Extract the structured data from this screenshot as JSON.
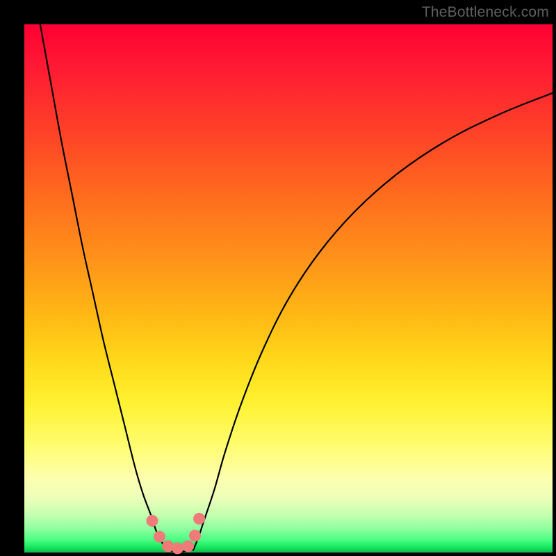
{
  "watermark": "TheBottleneck.com",
  "colors": {
    "frame": "#000000",
    "curve_stroke": "#000000",
    "marker_fill": "#ef7b78",
    "marker_stroke": "#c96562",
    "gradient_top": "#ff0033",
    "gradient_bottom": "#0fb74a"
  },
  "chart_data": {
    "type": "line",
    "title": "",
    "xlabel": "",
    "ylabel": "",
    "xlim": [
      0,
      100
    ],
    "ylim": [
      0,
      100
    ],
    "grid": false,
    "legend": false,
    "series": [
      {
        "name": "left-curve",
        "x": [
          3,
          5,
          7,
          9,
          11,
          13,
          15,
          17,
          19,
          21,
          22.5,
          24,
          25,
          26,
          27
        ],
        "y": [
          100,
          89,
          78,
          68,
          58,
          49,
          40,
          32,
          24,
          16,
          11,
          7,
          4,
          2,
          0.5
        ]
      },
      {
        "name": "right-curve",
        "x": [
          32,
          33,
          34,
          36,
          38,
          41,
          45,
          50,
          56,
          63,
          71,
          80,
          90,
          100
        ],
        "y": [
          0.5,
          3,
          6,
          12,
          19,
          28,
          38,
          48,
          57,
          65,
          72,
          78,
          83,
          87
        ]
      },
      {
        "name": "valley-floor",
        "x": [
          27,
          28.5,
          30,
          31,
          32
        ],
        "y": [
          0.5,
          0.2,
          0.2,
          0.3,
          0.5
        ]
      }
    ],
    "markers": {
      "name": "highlighted-points",
      "x": [
        24.2,
        25.6,
        27.2,
        29.0,
        31.0,
        32.3,
        33.1
      ],
      "y": [
        6.0,
        3.0,
        1.2,
        0.8,
        1.2,
        3.2,
        6.4
      ]
    }
  }
}
